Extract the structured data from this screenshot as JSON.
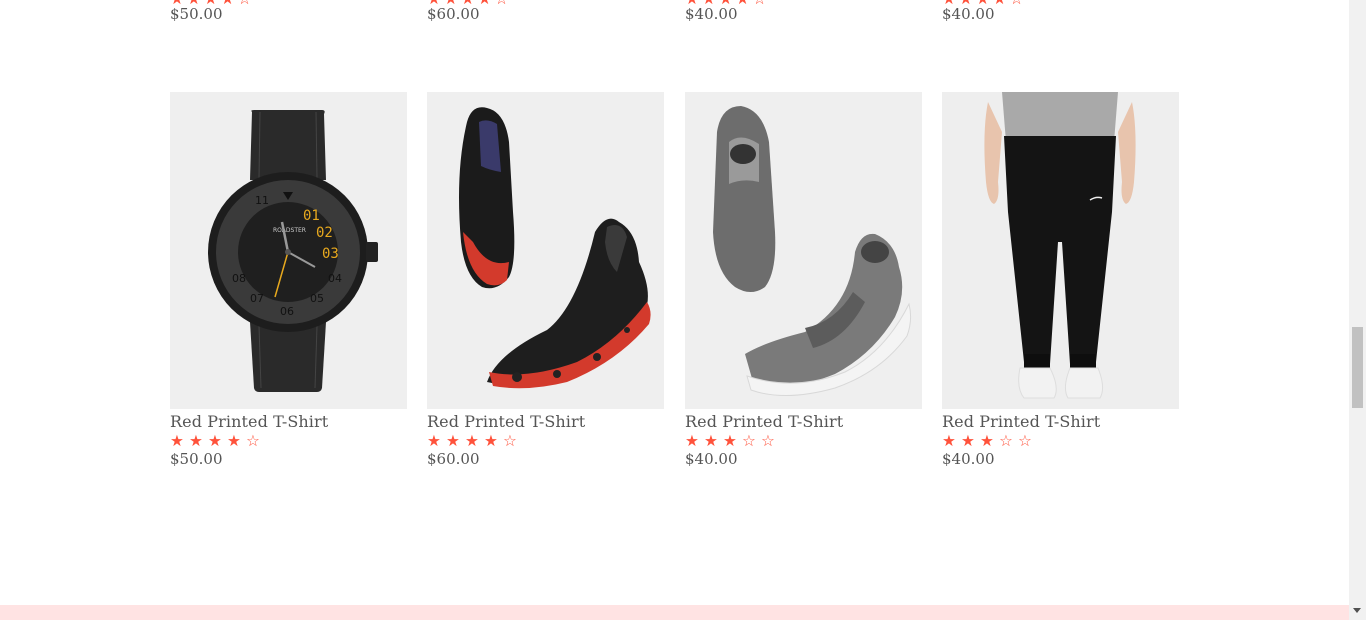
{
  "top_row": [
    {
      "stars": "★★★★☆",
      "price": "$50.00"
    },
    {
      "stars": "★★★★☆",
      "price": "$60.00"
    },
    {
      "stars": "★★★★☆",
      "price": "$40.00"
    },
    {
      "stars": "★★★★☆",
      "price": "$40.00"
    }
  ],
  "products": [
    {
      "name": "Red Printed T-Shirt",
      "price": "$50.00",
      "rating": 4.0,
      "image": "watch-image"
    },
    {
      "name": "Red Printed T-Shirt",
      "price": "$60.00",
      "rating": 4.5,
      "image": "sneakers-black-image"
    },
    {
      "name": "Red Printed T-Shirt",
      "price": "$40.00",
      "rating": 3.5,
      "image": "sneakers-grey-image"
    },
    {
      "name": "Red Printed T-Shirt",
      "price": "$40.00",
      "rating": 3.5,
      "image": "joggers-image"
    }
  ],
  "colors": {
    "star": "#ff523b",
    "footer_band": "#ffe3e3",
    "card_bg": "#efefef"
  }
}
